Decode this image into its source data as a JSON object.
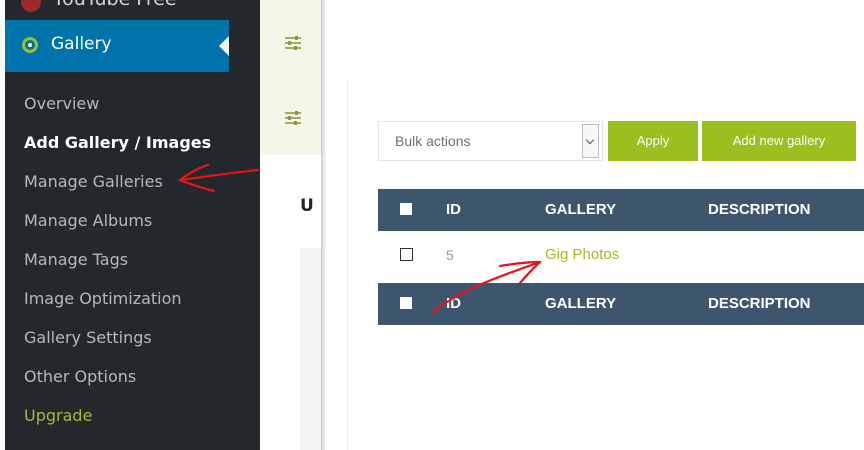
{
  "sidebar": {
    "top_item_label": "YouTube Free",
    "active_menu": {
      "label": "Gallery"
    },
    "submenu": [
      {
        "label": "Overview"
      },
      {
        "label": "Add Gallery / Images"
      },
      {
        "label": "Manage Galleries"
      },
      {
        "label": "Manage Albums"
      },
      {
        "label": "Manage Tags"
      },
      {
        "label": "Image Optimization"
      },
      {
        "label": "Gallery Settings"
      },
      {
        "label": "Other Options"
      },
      {
        "label": "Upgrade"
      }
    ]
  },
  "middle_panel": {
    "partial_heading": "U"
  },
  "toolbar": {
    "bulk_select_value": "Bulk actions",
    "apply_label": "Apply",
    "add_new_label": "Add new gallery"
  },
  "table": {
    "columns": [
      "ID",
      "GALLERY",
      "DESCRIPTION"
    ],
    "rows": [
      {
        "id": "5",
        "gallery": "Gig Photos"
      }
    ]
  },
  "colors": {
    "sidebar_bg": "#23282d",
    "active_blue": "#0073aa",
    "accent_green": "#9bbf1e",
    "table_header": "#3d566e",
    "annotation_red": "#e8141b"
  }
}
